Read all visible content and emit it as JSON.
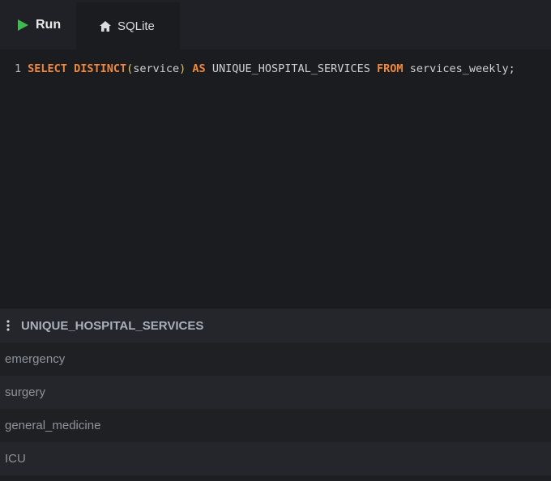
{
  "toolbar": {
    "run_label": "Run",
    "tab_label": "SQLite"
  },
  "editor": {
    "line_number": "1",
    "tokens": {
      "select": "SELECT",
      "distinct": "DISTINCT",
      "open_paren": "(",
      "column": "service",
      "close_paren": ")",
      "as": "AS",
      "alias": "UNIQUE_HOSPITAL_SERVICES",
      "from": "FROM",
      "table": "services_weekly;"
    }
  },
  "results": {
    "column_header": "UNIQUE_HOSPITAL_SERVICES",
    "rows": [
      "emergency",
      "surgery",
      "general_medicine",
      "ICU"
    ]
  },
  "colors": {
    "background": "#1b1c20",
    "keyword": "#f0883e",
    "run_icon": "#3fb950",
    "paren": "#e0c75b"
  },
  "icons": {
    "run": "play-icon",
    "tab": "home-icon",
    "column_menu": "kebab-icon"
  }
}
